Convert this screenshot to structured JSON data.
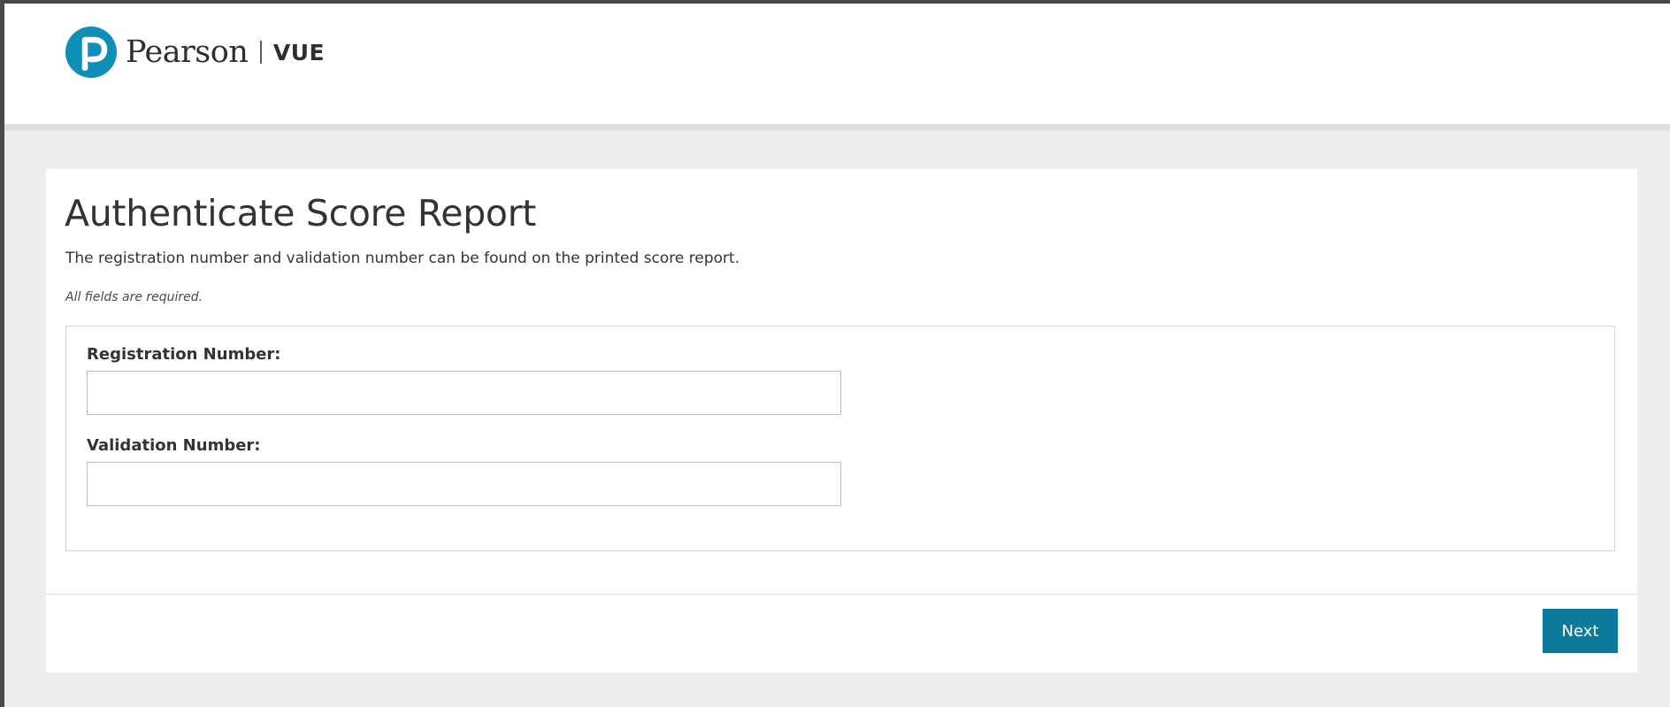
{
  "header": {
    "brand_name": "Pearson",
    "product_name": "VUE"
  },
  "page": {
    "title": "Authenticate Score Report",
    "intro": "The registration number and validation number can be found on the printed score report.",
    "required_note": "All fields are required."
  },
  "form": {
    "registration": {
      "label": "Registration Number:",
      "value": ""
    },
    "validation": {
      "label": "Validation Number:",
      "value": ""
    }
  },
  "actions": {
    "next_label": "Next"
  },
  "icons": {
    "logo": "pearson-logo-icon"
  },
  "colors": {
    "brand": "#0f8fb8",
    "primary_button": "#0b7a9b"
  }
}
